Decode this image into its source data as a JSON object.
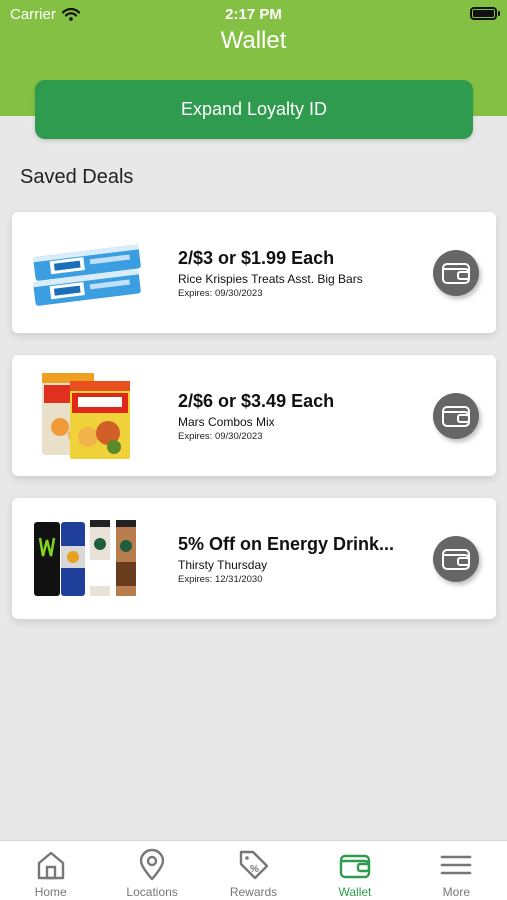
{
  "status_bar": {
    "carrier": "Carrier",
    "time": "2:17 PM"
  },
  "header": {
    "title": "Wallet"
  },
  "loyalty": {
    "button_label": "Expand Loyalty ID"
  },
  "saved_deals": {
    "title": "Saved Deals",
    "items": [
      {
        "title": "2/$3 or $1.99 Each",
        "description": "Rice Krispies Treats Asst. Big Bars",
        "expires": "Expires: 09/30/2023",
        "image": "rice-krispies-treats"
      },
      {
        "title": "2/$6 or $3.49 Each",
        "description": "Mars Combos Mix",
        "expires": "Expires: 09/30/2023",
        "image": "combos-bags"
      },
      {
        "title": "5% Off on Energy Drink...",
        "description": "Thirsty Thursday",
        "expires": "Expires: 12/31/2030",
        "image": "energy-drinks"
      }
    ]
  },
  "tabbar": {
    "items": [
      {
        "label": "Home",
        "icon": "home-icon",
        "active": false
      },
      {
        "label": "Locations",
        "icon": "location-pin-icon",
        "active": false
      },
      {
        "label": "Rewards",
        "icon": "tag-percent-icon",
        "active": false
      },
      {
        "label": "Wallet",
        "icon": "wallet-icon",
        "active": true
      },
      {
        "label": "More",
        "icon": "menu-icon",
        "active": false
      }
    ]
  },
  "colors": {
    "header": "#84c043",
    "accent": "#2e9b4e",
    "wallet_button": "#666666",
    "inactive_tab": "#777777"
  }
}
